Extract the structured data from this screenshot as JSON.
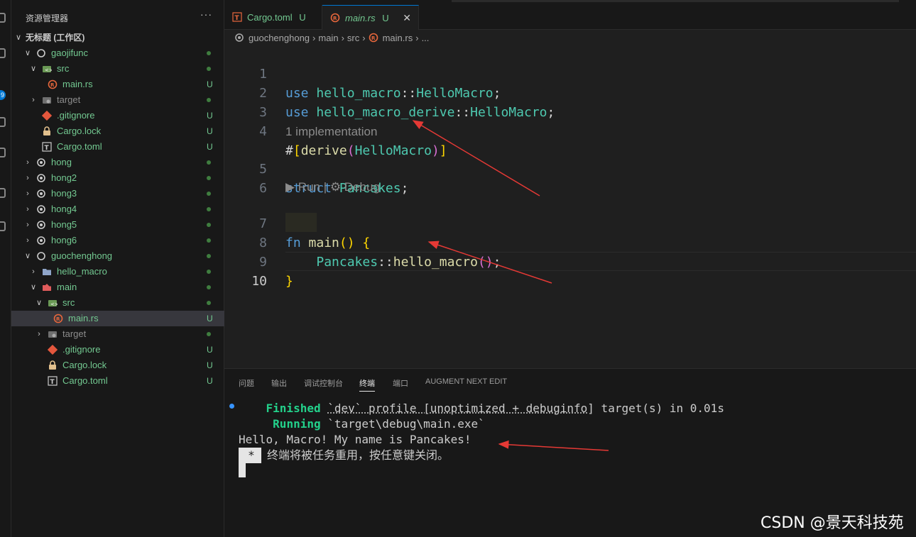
{
  "sidebar": {
    "title": "资源管理器",
    "more": "···",
    "workspace": "无标题 (工作区)",
    "items": [
      {
        "label": "gaojifunc"
      },
      {
        "label": "src"
      },
      {
        "label": "main.rs",
        "status": "U"
      },
      {
        "label": "target"
      },
      {
        "label": ".gitignore",
        "status": "U"
      },
      {
        "label": "Cargo.lock",
        "status": "U"
      },
      {
        "label": "Cargo.toml",
        "status": "U"
      },
      {
        "label": "hong"
      },
      {
        "label": "hong2"
      },
      {
        "label": "hong3"
      },
      {
        "label": "hong4"
      },
      {
        "label": "hong5"
      },
      {
        "label": "hong6"
      },
      {
        "label": "guochenghong"
      },
      {
        "label": "hello_macro"
      },
      {
        "label": "main"
      },
      {
        "label": "src"
      },
      {
        "label": "main.rs",
        "status": "U"
      },
      {
        "label": "target"
      },
      {
        "label": ".gitignore",
        "status": "U"
      },
      {
        "label": "Cargo.lock",
        "status": "U"
      },
      {
        "label": "Cargo.toml",
        "status": "U"
      }
    ]
  },
  "activity": {
    "badge": "9"
  },
  "tabs": [
    {
      "label": "Cargo.toml",
      "status": "U"
    },
    {
      "label": "main.rs",
      "status": "U",
      "close": "✕"
    }
  ],
  "breadcrumb": {
    "parts": [
      "guochenghong",
      "main",
      "src",
      "main.rs",
      "..."
    ]
  },
  "editor": {
    "line_numbers": [
      "1",
      "2",
      "3",
      "4",
      "5",
      "6",
      "7",
      "8",
      "9",
      "10"
    ],
    "lines": {
      "l1": {
        "kw": "use",
        "a": "hello_macro",
        "sep": "::",
        "b": "HelloMacro",
        "end": ";"
      },
      "l2": {
        "kw": "use",
        "a": "hello_macro_derive",
        "sep": "::",
        "b": "HelloMacro",
        "end": ";"
      },
      "l4": {
        "hash": "#",
        "open": "[",
        "attr": "derive",
        "popen": "(",
        "arg": "HelloMacro",
        "pclose": ")",
        "close": "]"
      },
      "l5": {
        "kw": "struct",
        "name": "Pancakes",
        "end": ";"
      },
      "l7": {
        "kw": "fn",
        "name": "main",
        "parens": "()",
        "brace": "{"
      },
      "l8": {
        "ty": "Pancakes",
        "sep": "::",
        "fn": "hello_macro",
        "parens": "()",
        "end": ";"
      },
      "l9": {
        "brace": "}"
      }
    },
    "codelens_impl": "1 implementation",
    "codelens_run": "▶ Run | ⚙ Debug"
  },
  "panel": {
    "tabs": [
      "问题",
      "输出",
      "调试控制台",
      "终端",
      "端口",
      "AUGMENT NEXT EDIT"
    ],
    "active_tab": "终端",
    "terminal": {
      "finished_label": "Finished",
      "finished_profile": "`dev` profile [unoptimized + debuginfo]",
      "finished_rest": " target(s) in 0.01s",
      "running_label": "Running",
      "running_rest": " `target\\debug\\main.exe`",
      "output": "Hello, Macro! My name is Pancakes!",
      "star": "*",
      "reuse_msg": "终端将被任务重用，按任意键关闭。"
    }
  },
  "watermark": "CSDN @景天科技苑",
  "colors": {
    "accent": "#0078d4",
    "untracked": "#73c991",
    "annotation_arrow": "#e53935"
  }
}
